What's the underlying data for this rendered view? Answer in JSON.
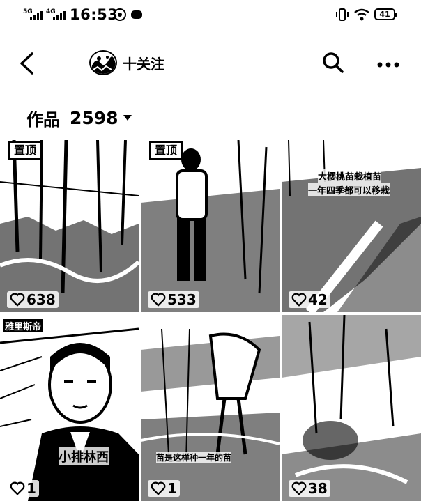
{
  "status_bar": {
    "signal1": "5G",
    "signal2": "4G",
    "time": "16:53",
    "battery": "41"
  },
  "nav": {
    "back_icon": "chevron-left-icon",
    "follow_label": "十关注",
    "search_icon": "search-icon",
    "more_icon": "more-icon"
  },
  "works": {
    "label": "作品",
    "count": "2598"
  },
  "tiles": [
    {
      "pinned": "置顶",
      "likes": "638"
    },
    {
      "pinned": "置顶",
      "likes": "533"
    },
    {
      "likes": "42",
      "caption1": "大樱桃苗栽植苗",
      "caption2": "一年四季都可以移栽"
    },
    {
      "likes": "1",
      "tag": "雅里斯帝",
      "caption": "小排林西"
    },
    {
      "likes": "1",
      "caption": "苗是这样种一年的苗"
    },
    {
      "likes": "38"
    }
  ]
}
